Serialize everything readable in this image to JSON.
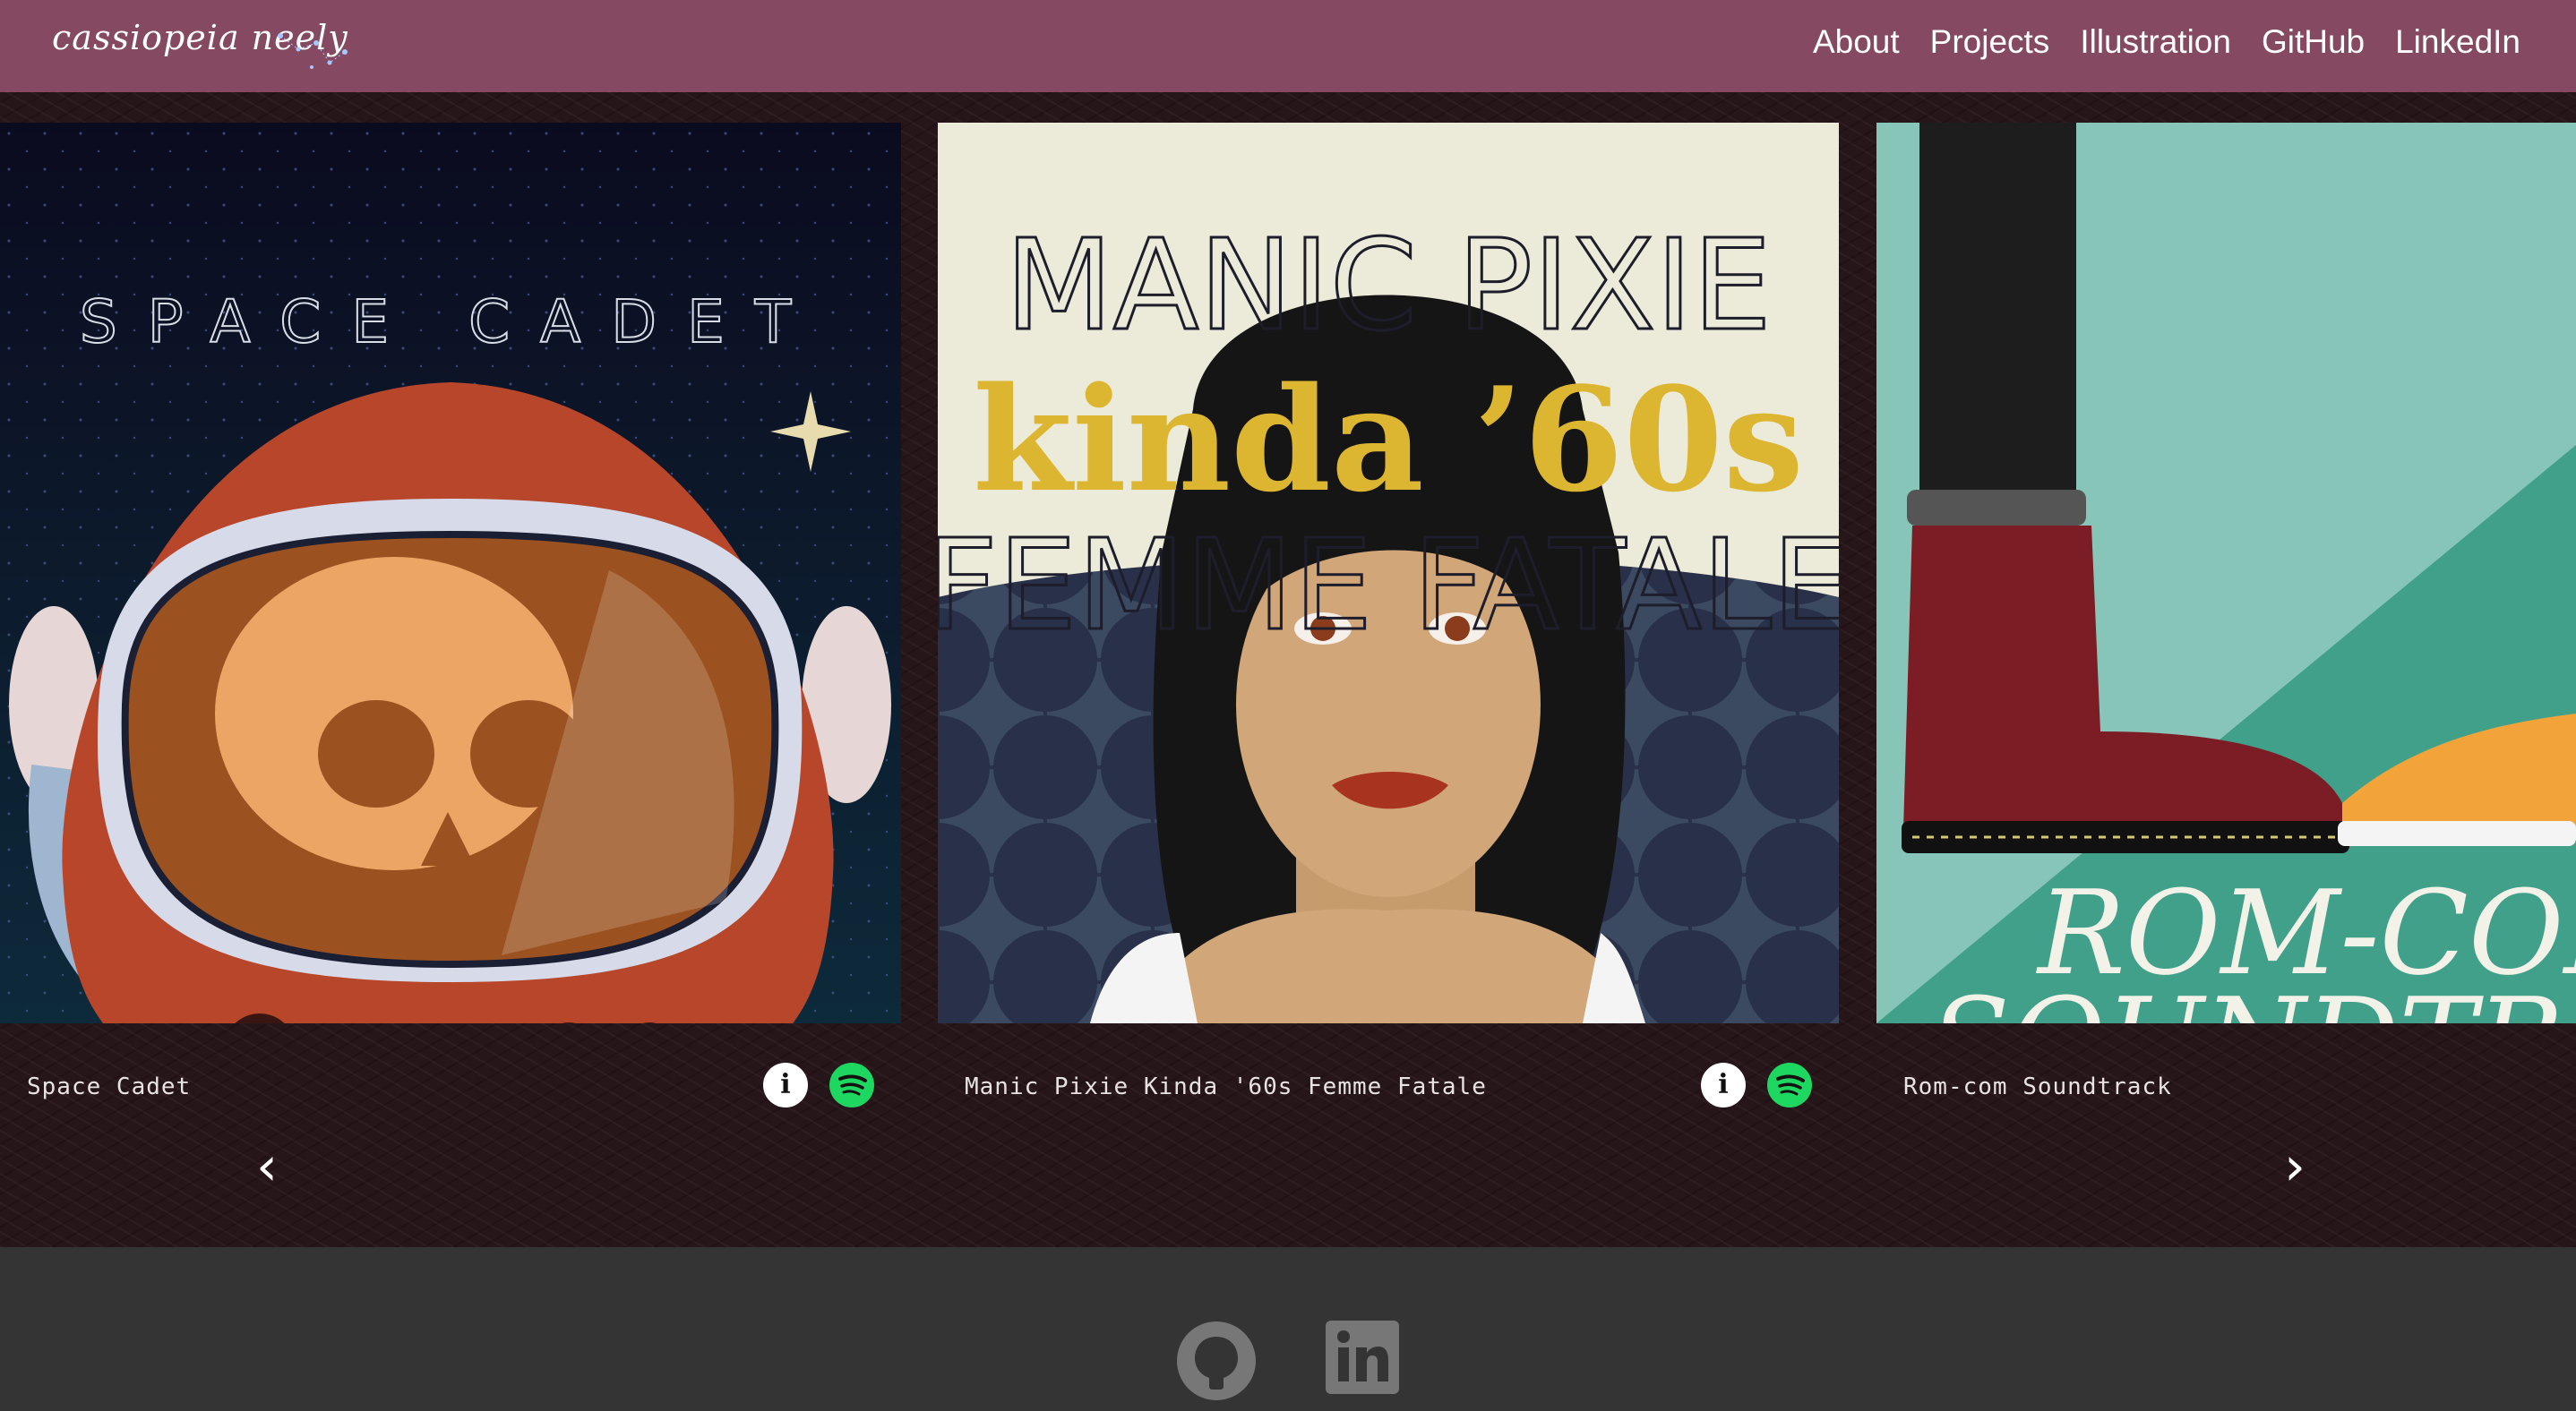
{
  "brand": {
    "name": "cassiopeia neely"
  },
  "nav": {
    "items": [
      {
        "label": "About"
      },
      {
        "label": "Projects"
      },
      {
        "label": "Illustration"
      },
      {
        "label": "GitHub"
      },
      {
        "label": "LinkedIn"
      }
    ]
  },
  "carousel": {
    "prev_label": "‹",
    "next_label": "›",
    "cards": [
      {
        "title": "Space Cadet",
        "art_text": "SPACE CADET",
        "info_icon": "info-icon",
        "spotify_icon": "spotify-icon"
      },
      {
        "title": "Manic Pixie Kinda '60s Femme Fatale",
        "art_line1": "MANIC PIXIE",
        "art_line2": "kinda ’60s",
        "art_line3": "FEMME FATALE",
        "info_icon": "info-icon",
        "spotify_icon": "spotify-icon"
      },
      {
        "title": "Rom-com Soundtrack",
        "art_line1": "ROM-COM",
        "art_line2": "SOUNDTRACK"
      }
    ]
  },
  "footer": {
    "icons": [
      "github-icon",
      "linkedin-icon"
    ]
  },
  "colors": {
    "navbar": "#854a62",
    "background": "#261519",
    "footer": "#343434",
    "spotify": "#1ed760"
  }
}
